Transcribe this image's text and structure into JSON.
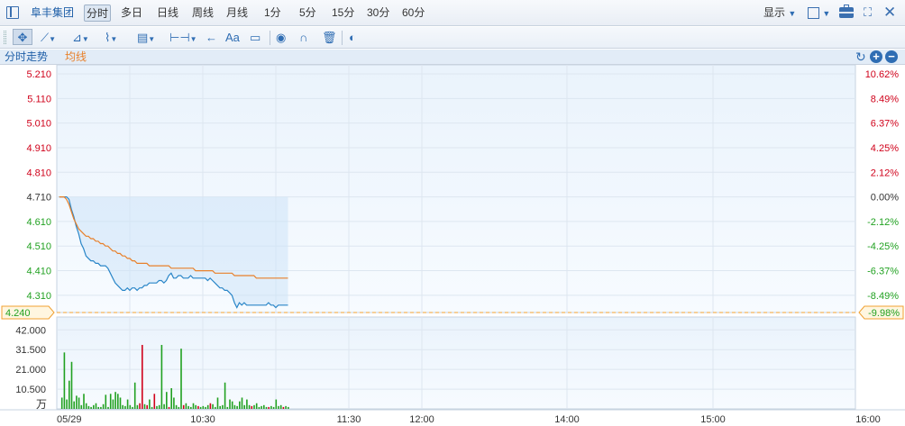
{
  "toolbar": {
    "stock_name": "阜丰集团",
    "periods": [
      "分时",
      "多日",
      "日线",
      "周线",
      "月线",
      "1分",
      "5分",
      "15分",
      "30分",
      "60分"
    ],
    "active_period": "分时",
    "display_label": "显示"
  },
  "legend": {
    "line_label": "分时走势",
    "avg_label": "均线"
  },
  "colors": {
    "up": "#d0021b",
    "down": "#21a121",
    "flat": "#333333",
    "price_line": "#2a86c8",
    "avg_line": "#e8802a",
    "current_line": "#f0a030"
  },
  "icons": {
    "layout": "panel-toggle-icon",
    "refresh": "refresh-icon",
    "zoom_in": "zoom-in-icon",
    "zoom_out": "zoom-out-icon",
    "toolbox": "toolbox-icon",
    "fullscreen": "fullscreen-icon"
  },
  "chart_data": {
    "type": "line",
    "prev_close": 4.71,
    "current_price": 4.24,
    "current_change": "-9.98%",
    "y_ticks": [
      {
        "value": 5.21,
        "label": "5.210",
        "pct": "10.62%"
      },
      {
        "value": 5.11,
        "label": "5.110",
        "pct": "8.49%"
      },
      {
        "value": 5.01,
        "label": "5.010",
        "pct": "6.37%"
      },
      {
        "value": 4.91,
        "label": "4.910",
        "pct": "4.25%"
      },
      {
        "value": 4.81,
        "label": "4.810",
        "pct": "2.12%"
      },
      {
        "value": 4.71,
        "label": "4.710",
        "pct": "0.00%"
      },
      {
        "value": 4.61,
        "label": "4.610",
        "pct": "-2.12%"
      },
      {
        "value": 4.51,
        "label": "4.510",
        "pct": "-4.25%"
      },
      {
        "value": 4.41,
        "label": "4.410",
        "pct": "-6.37%"
      },
      {
        "value": 4.31,
        "label": "4.310",
        "pct": "-8.49%"
      }
    ],
    "current_label": "4.240",
    "volume_ticks": [
      {
        "value": 42000,
        "label": "42.000"
      },
      {
        "value": 31500,
        "label": "31.500"
      },
      {
        "value": 21000,
        "label": "21.000"
      },
      {
        "value": 10500,
        "label": "10.500"
      }
    ],
    "volume_unit": "万",
    "x_ticks": [
      "05/29",
      "10:30",
      "11:30",
      "12:00",
      "14:00",
      "15:00",
      "16:00"
    ],
    "price": [
      4.71,
      4.71,
      4.71,
      4.71,
      4.7,
      4.66,
      4.63,
      4.59,
      4.56,
      4.52,
      4.5,
      4.47,
      4.46,
      4.45,
      4.45,
      4.44,
      4.44,
      4.43,
      4.43,
      4.43,
      4.42,
      4.4,
      4.38,
      4.36,
      4.35,
      4.34,
      4.33,
      4.33,
      4.34,
      4.33,
      4.34,
      4.34,
      4.33,
      4.34,
      4.34,
      4.35,
      4.35,
      4.36,
      4.36,
      4.36,
      4.36,
      4.37,
      4.37,
      4.36,
      4.37,
      4.39,
      4.4,
      4.38,
      4.38,
      4.39,
      4.39,
      4.38,
      4.38,
      4.38,
      4.39,
      4.38,
      4.38,
      4.38,
      4.38,
      4.38,
      4.38,
      4.37,
      4.38,
      4.37,
      4.36,
      4.35,
      4.34,
      4.34,
      4.33,
      4.33,
      4.32,
      4.31,
      4.28,
      4.26,
      4.28,
      4.27,
      4.28,
      4.27,
      4.27,
      4.27,
      4.27,
      4.27,
      4.27,
      4.27,
      4.27,
      4.27,
      4.28,
      4.27,
      4.27,
      4.26,
      4.27,
      4.27,
      4.27,
      4.27,
      4.27
    ],
    "avg": [
      4.71,
      4.71,
      4.71,
      4.7,
      4.68,
      4.65,
      4.62,
      4.6,
      4.58,
      4.57,
      4.56,
      4.55,
      4.55,
      4.54,
      4.54,
      4.53,
      4.53,
      4.52,
      4.52,
      4.51,
      4.51,
      4.5,
      4.49,
      4.49,
      4.48,
      4.48,
      4.47,
      4.47,
      4.46,
      4.46,
      4.45,
      4.45,
      4.44,
      4.44,
      4.44,
      4.44,
      4.44,
      4.43,
      4.43,
      4.43,
      4.43,
      4.43,
      4.43,
      4.43,
      4.43,
      4.43,
      4.42,
      4.42,
      4.42,
      4.42,
      4.42,
      4.42,
      4.42,
      4.42,
      4.42,
      4.42,
      4.41,
      4.41,
      4.41,
      4.41,
      4.41,
      4.41,
      4.41,
      4.41,
      4.4,
      4.4,
      4.4,
      4.4,
      4.4,
      4.4,
      4.4,
      4.4,
      4.39,
      4.39,
      4.39,
      4.39,
      4.39,
      4.39,
      4.39,
      4.39,
      4.39,
      4.38,
      4.38,
      4.38,
      4.38,
      4.38,
      4.38,
      4.38,
      4.38,
      4.38,
      4.38,
      4.38,
      4.38,
      4.38,
      4.38
    ],
    "volume": [
      0,
      6000,
      30000,
      5000,
      15000,
      25000,
      4000,
      7000,
      6000,
      2000,
      8000,
      3000,
      1500,
      1000,
      2000,
      3000,
      1000,
      1000,
      2500,
      7500,
      1000,
      8000,
      5000,
      9000,
      8000,
      6000,
      2000,
      1500,
      5000,
      2000,
      1000,
      14000,
      2000,
      3000,
      34000,
      2500,
      2000,
      5000,
      1000,
      8000,
      1500,
      2000,
      34000,
      2500,
      9000,
      1000,
      11000,
      6000,
      2000,
      1000,
      32000,
      2000,
      3000,
      1500,
      1000,
      3000,
      2000,
      1500,
      1000,
      1500,
      1000,
      2000,
      3000,
      2500,
      1000,
      6000,
      1500,
      2000,
      14000,
      1000,
      5000,
      4000,
      2000,
      1500,
      4000,
      6000,
      2000,
      5000,
      2000,
      1500,
      2000,
      3000,
      1000,
      1500,
      2000,
      1000,
      1000,
      1500,
      1000,
      5000,
      1500,
      2000,
      1000,
      1500,
      1000
    ],
    "volume_dir": [
      "f",
      "d",
      "d",
      "d",
      "d",
      "d",
      "d",
      "d",
      "d",
      "d",
      "d",
      "d",
      "d",
      "d",
      "d",
      "d",
      "d",
      "d",
      "d",
      "d",
      "d",
      "d",
      "d",
      "d",
      "d",
      "d",
      "d",
      "d",
      "d",
      "d",
      "d",
      "d",
      "d",
      "u",
      "u",
      "d",
      "u",
      "d",
      "d",
      "u",
      "d",
      "d",
      "d",
      "d",
      "d",
      "u",
      "d",
      "d",
      "d",
      "d",
      "d",
      "u",
      "d",
      "d",
      "d",
      "d",
      "d",
      "u",
      "d",
      "d",
      "d",
      "d",
      "u",
      "d",
      "d",
      "d",
      "d",
      "d",
      "d",
      "d",
      "d",
      "d",
      "d",
      "d",
      "d",
      "d",
      "d",
      "d",
      "d",
      "u",
      "d",
      "d",
      "d",
      "d",
      "d",
      "d",
      "u",
      "d",
      "d",
      "d",
      "d",
      "d",
      "u",
      "d",
      "d"
    ]
  }
}
